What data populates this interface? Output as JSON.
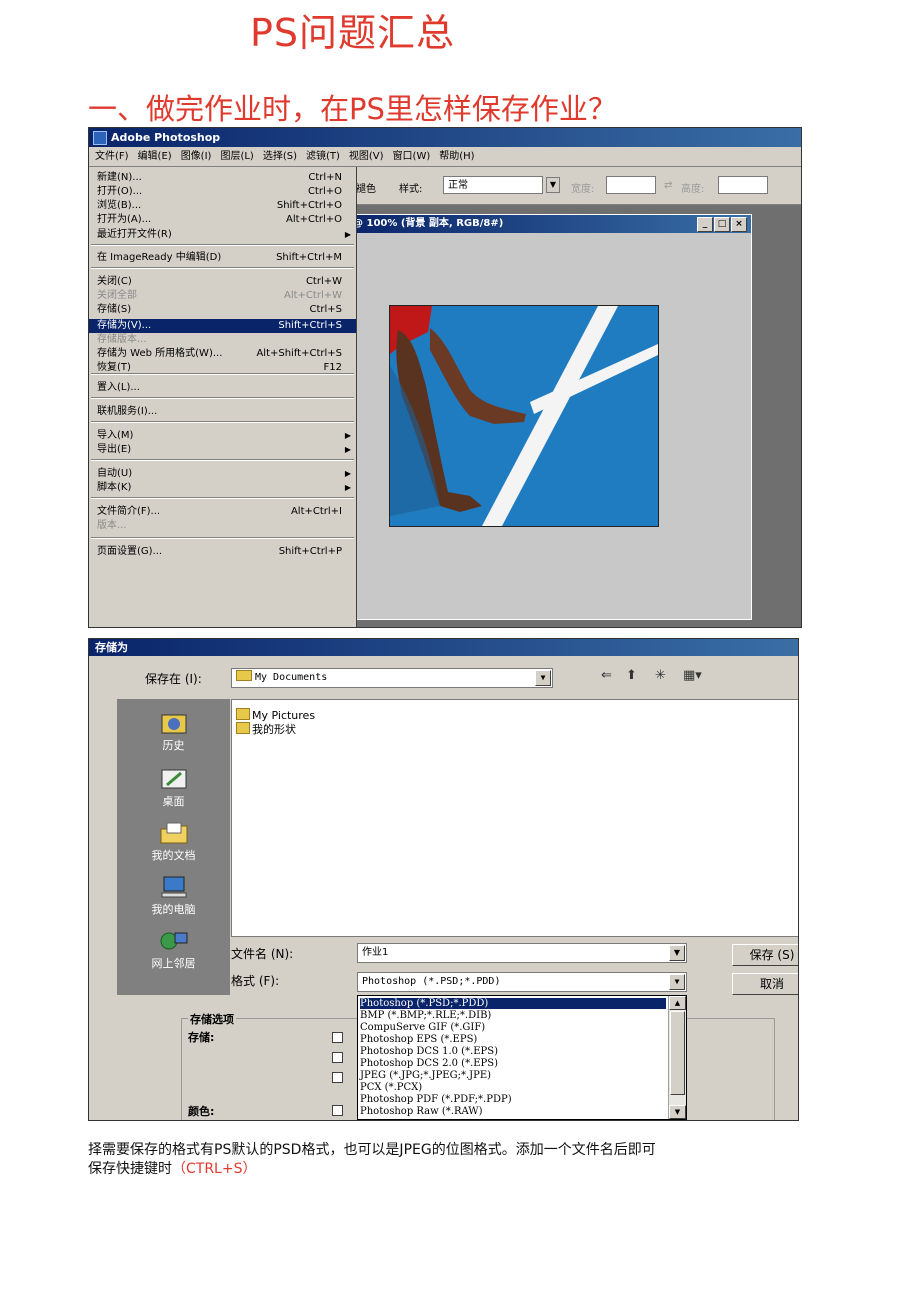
{
  "doc": {
    "title": "PS问题汇总",
    "heading": "一、做完作业时，在PS里怎样保存作业？",
    "body_line1": "择需要保存的格式有PS默认的PSD格式，也可以是JPEG的位图格式。添加一个文件名后即可",
    "body_line2_prefix": "保存快捷键时",
    "body_line2_shortcut": "（CTRL+S）"
  },
  "photoshop": {
    "app_title": "Adobe Photoshop",
    "menubar": [
      "文件(F)",
      "编辑(E)",
      "图像(I)",
      "图层(L)",
      "选择(S)",
      "滤镜(T)",
      "视图(V)",
      "窗口(W)",
      "帮助(H)"
    ],
    "options": {
      "fragment": "褪色",
      "style_label": "样式:",
      "style_value": "正常",
      "width_label": "宽度:",
      "height_label": "高度:"
    },
    "doc_window_title": "@ 100% (背景 副本, RGB/8#)",
    "file_menu": [
      {
        "label": "新建(N)...",
        "shortcut": "Ctrl+N"
      },
      {
        "label": "打开(O)...",
        "shortcut": "Ctrl+O"
      },
      {
        "label": "浏览(B)...",
        "shortcut": "Shift+Ctrl+O"
      },
      {
        "label": "打开为(A)...",
        "shortcut": "Alt+Ctrl+O"
      },
      {
        "label": "最近打开文件(R)",
        "shortcut": ""
      },
      {
        "label": "在 ImageReady 中编辑(D)",
        "shortcut": "Shift+Ctrl+M"
      },
      {
        "label": "关闭(C)",
        "shortcut": "Ctrl+W"
      },
      {
        "label": "关闭全部",
        "shortcut": "Alt+Ctrl+W"
      },
      {
        "label": "存储(S)",
        "shortcut": "Ctrl+S"
      },
      {
        "label": "存储为(V)...",
        "shortcut": "Shift+Ctrl+S"
      },
      {
        "label": "存储版本...",
        "shortcut": ""
      },
      {
        "label": "存储为 Web 所用格式(W)...",
        "shortcut": "Alt+Shift+Ctrl+S"
      },
      {
        "label": "恢复(T)",
        "shortcut": "F12"
      },
      {
        "label": "置入(L)...",
        "shortcut": ""
      },
      {
        "label": "联机服务(I)...",
        "shortcut": ""
      },
      {
        "label": "导入(M)",
        "shortcut": ""
      },
      {
        "label": "导出(E)",
        "shortcut": ""
      },
      {
        "label": "自动(U)",
        "shortcut": ""
      },
      {
        "label": "脚本(K)",
        "shortcut": ""
      },
      {
        "label": "文件简介(F)...",
        "shortcut": "Alt+Ctrl+I"
      },
      {
        "label": "版本...",
        "shortcut": ""
      },
      {
        "label": "页面设置(G)...",
        "shortcut": "Shift+Ctrl+P"
      }
    ]
  },
  "save_dialog": {
    "title": "存储为",
    "save_in_label": "保存在 (I):",
    "save_in_value": "My Documents",
    "files": [
      "My Pictures",
      "我的形状"
    ],
    "places": [
      "历史",
      "桌面",
      "我的文档",
      "我的电脑",
      "网上邻居"
    ],
    "filename_label": "文件名 (N):",
    "filename_value": "作业1",
    "format_label": "格式 (F):",
    "format_value": "Photoshop (*.PSD;*.PDD)",
    "save_button": "保存 (S)",
    "cancel_button": "取消",
    "format_options": [
      "Photoshop (*.PSD;*.PDD)",
      "BMP (*.BMP;*.RLE;*.DIB)",
      "CompuServe GIF (*.GIF)",
      "Photoshop EPS (*.EPS)",
      "Photoshop DCS 1.0 (*.EPS)",
      "Photoshop DCS 2.0 (*.EPS)",
      "JPEG (*.JPG;*.JPEG;*.JPE)",
      "PCX (*.PCX)",
      "Photoshop PDF (*.PDF;*.PDP)",
      "Photoshop Raw (*.RAW)"
    ],
    "options_group": "存储选项",
    "save_label": "存储:",
    "color_label": "颜色:"
  }
}
